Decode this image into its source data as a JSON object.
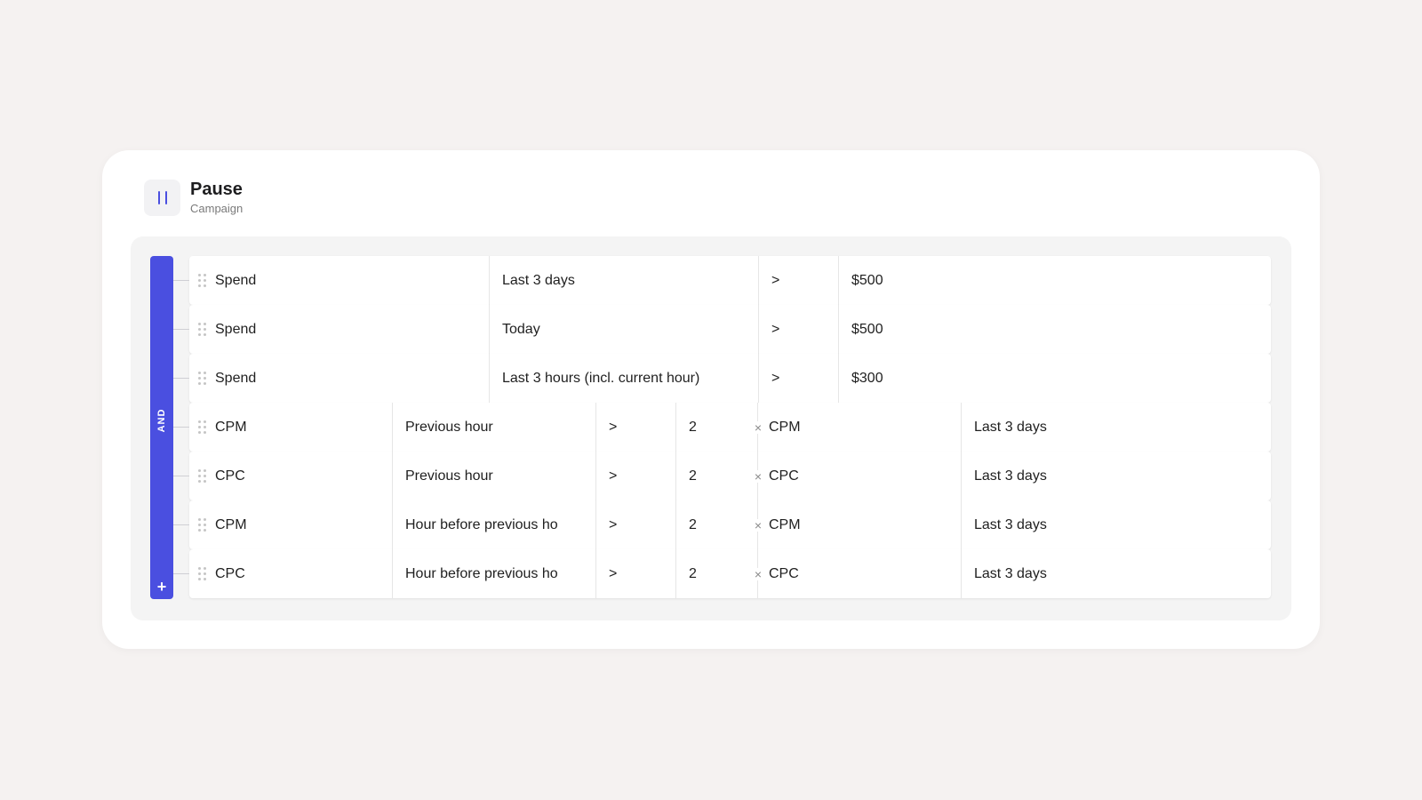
{
  "header": {
    "action_title": "Pause",
    "action_subtitle": "Campaign"
  },
  "group": {
    "operator": "AND",
    "add_label": "+"
  },
  "rows": [
    {
      "metric": "Spend",
      "period": "Last 3 days",
      "operator": ">",
      "value": "$500"
    },
    {
      "metric": "Spend",
      "period": "Today",
      "operator": ">",
      "value": "$500"
    },
    {
      "metric": "Spend",
      "period": "Last 3 hours (incl. current hour)",
      "operator": ">",
      "value": "$300"
    },
    {
      "metric": "CPM",
      "period": "Previous hour",
      "operator": ">",
      "multiplier": "2",
      "times": "×",
      "compare_metric": "CPM",
      "compare_period": "Last 3 days"
    },
    {
      "metric": "CPC",
      "period": "Previous hour",
      "operator": ">",
      "multiplier": "2",
      "times": "×",
      "compare_metric": "CPC",
      "compare_period": "Last 3 days"
    },
    {
      "metric": "CPM",
      "period": "Hour before previous ho",
      "operator": ">",
      "multiplier": "2",
      "times": "×",
      "compare_metric": "CPM",
      "compare_period": "Last 3 days"
    },
    {
      "metric": "CPC",
      "period": "Hour before previous ho",
      "operator": ">",
      "multiplier": "2",
      "times": "×",
      "compare_metric": "CPC",
      "compare_period": "Last 3 days"
    }
  ],
  "colors": {
    "accent": "#4a4fe0",
    "background": "#f5f2f1",
    "card": "#ffffff",
    "panel": "#f4f4f4"
  }
}
